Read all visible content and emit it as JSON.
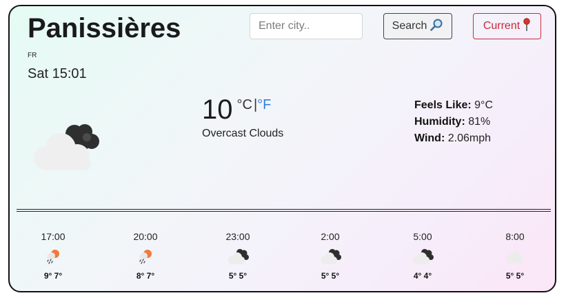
{
  "location": {
    "city": "Panissières",
    "country": "FR",
    "datetime": "Sat 15:01"
  },
  "search": {
    "placeholder": "Enter city..",
    "button_label": "Search",
    "button_icon": "magnifier-icon"
  },
  "current_button": {
    "label": "Current",
    "icon": "pushpin-icon"
  },
  "weather": {
    "temperature": "10",
    "unit_c": "°C",
    "unit_separator": "|",
    "unit_f": "°F",
    "description": "Overcast Clouds",
    "icon": "overcast-clouds-icon"
  },
  "details": {
    "feels_like_label": "Feels Like:",
    "feels_like_value": "9°C",
    "humidity_label": "Humidity:",
    "humidity_value": "81%",
    "wind_label": "Wind:",
    "wind_value": "2.06mph"
  },
  "forecast": [
    {
      "time": "17:00",
      "temps": "9° 7°",
      "icon": "light-rain-icon"
    },
    {
      "time": "20:00",
      "temps": "8° 7°",
      "icon": "light-rain-icon"
    },
    {
      "time": "23:00",
      "temps": "5° 5°",
      "icon": "overcast-clouds-icon"
    },
    {
      "time": "2:00",
      "temps": "5° 5°",
      "icon": "overcast-clouds-icon"
    },
    {
      "time": "5:00",
      "temps": "4° 4°",
      "icon": "overcast-clouds-icon"
    },
    {
      "time": "8:00",
      "temps": "5° 5°",
      "icon": "cloud-icon"
    }
  ],
  "colors": {
    "accent_blue": "#2f7de1",
    "current_red": "#cc2a3a"
  }
}
